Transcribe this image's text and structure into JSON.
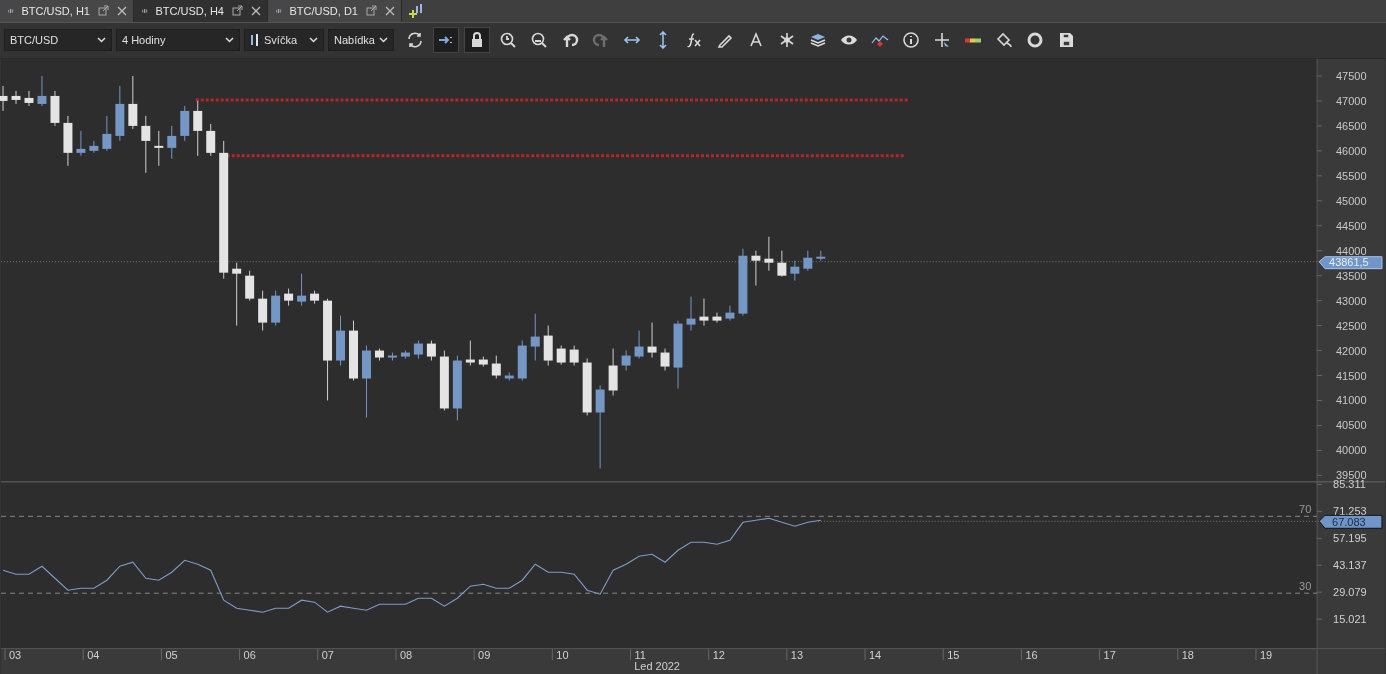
{
  "tabs": [
    {
      "label": "BTC/USD, H1",
      "selected": false
    },
    {
      "label": "BTC/USD, H4",
      "selected": true
    },
    {
      "label": "BTC/USD, D1",
      "selected": false
    }
  ],
  "toolbar": {
    "dropdowns": [
      {
        "value": "BTC/USD",
        "kind": "plain"
      },
      {
        "value": "4 Hodiny",
        "kind": "plain"
      },
      {
        "value": "Svíčka",
        "kind": "candle"
      },
      {
        "value": "Nabídka",
        "kind": "plain"
      }
    ],
    "tools": [
      {
        "kind": "refresh",
        "on": false,
        "disabled": false
      },
      {
        "kind": "autoscroll",
        "on": true,
        "disabled": false
      },
      {
        "kind": "lock",
        "on": true,
        "disabled": false
      },
      {
        "kind": "zoom-in",
        "on": false,
        "disabled": false
      },
      {
        "kind": "zoom-out",
        "on": false,
        "disabled": false
      },
      {
        "kind": "undo",
        "on": false,
        "disabled": false
      },
      {
        "kind": "redo",
        "on": false,
        "disabled": true
      },
      {
        "kind": "h-arrows",
        "on": false,
        "disabled": false
      },
      {
        "kind": "v-arrows",
        "on": false,
        "disabled": false
      },
      {
        "kind": "fx",
        "on": false,
        "disabled": false
      },
      {
        "kind": "pencil",
        "on": false,
        "disabled": false
      },
      {
        "kind": "text",
        "on": false,
        "disabled": false
      },
      {
        "kind": "nodes",
        "on": false,
        "disabled": false
      },
      {
        "kind": "layers",
        "on": false,
        "disabled": false
      },
      {
        "kind": "eye",
        "on": false,
        "disabled": false
      },
      {
        "kind": "alert",
        "on": false,
        "disabled": false
      },
      {
        "kind": "info",
        "on": false,
        "disabled": false
      },
      {
        "kind": "crosshair",
        "on": false,
        "disabled": false
      },
      {
        "kind": "colors",
        "on": false,
        "disabled": false
      },
      {
        "kind": "bucket",
        "on": false,
        "disabled": false
      },
      {
        "kind": "ring",
        "on": false,
        "disabled": false
      },
      {
        "kind": "save",
        "on": false,
        "disabled": false
      }
    ]
  },
  "price_chart": {
    "axis_labels": [
      "47500",
      "47000",
      "46500",
      "46000",
      "45500",
      "45000",
      "44500",
      "44000",
      "43500",
      "43000",
      "42500",
      "42000",
      "41500",
      "41000",
      "40500",
      "40000",
      "39500"
    ],
    "current_price": "43861,5"
  },
  "rsi_panel": {
    "axis_labels": [
      "85.311",
      "71.253",
      "57.195",
      "43.137",
      "29.079",
      "15.021"
    ],
    "level_labels": [
      "70",
      "30"
    ],
    "current_value": "67.083"
  },
  "time_axis": {
    "day_labels": [
      "03",
      "04",
      "05",
      "06",
      "07",
      "08",
      "09",
      "10",
      "11",
      "12",
      "13",
      "14",
      "15",
      "16",
      "17",
      "18",
      "19"
    ],
    "month_label": "Led 2022"
  }
}
